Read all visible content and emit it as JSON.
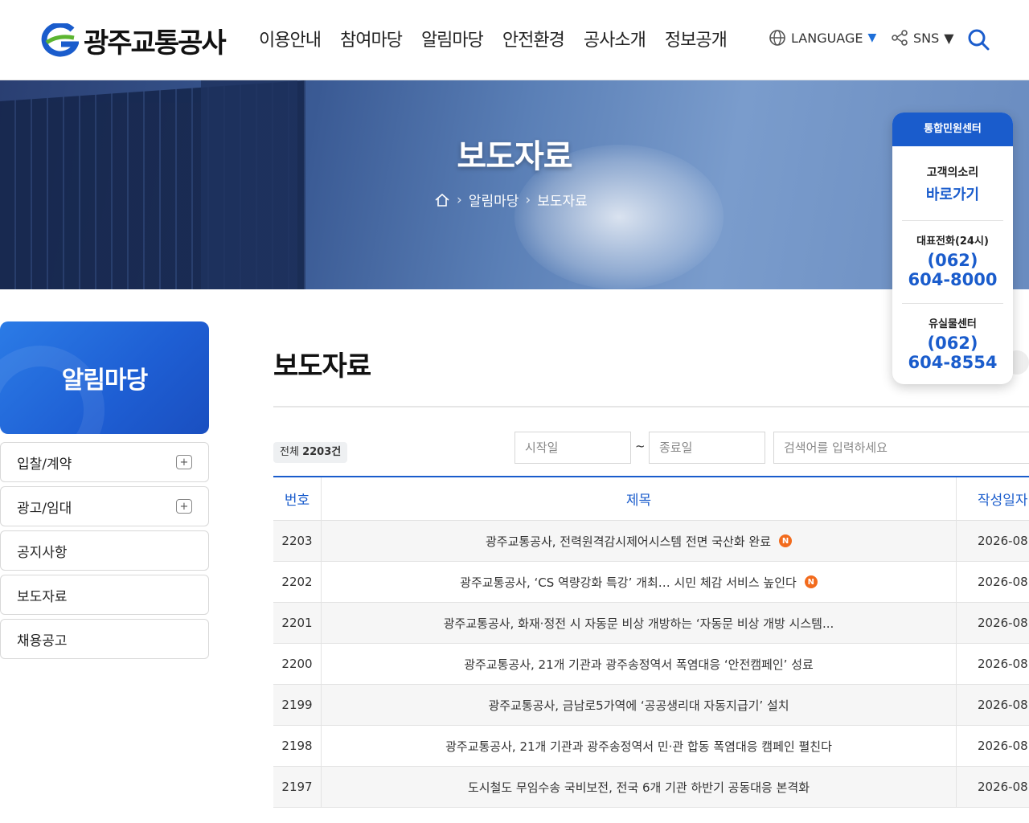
{
  "header": {
    "logo_text": "광주교통공사",
    "nav": [
      "이용안내",
      "참여마당",
      "알림마당",
      "안전환경",
      "공사소개",
      "정보공개"
    ],
    "language_label": "LANGUAGE",
    "sns_label": "SNS",
    "accent": "#1a5ccc"
  },
  "hero": {
    "title": "보도자료",
    "breadcrumb": [
      "알림마당",
      "보도자료"
    ]
  },
  "contact": {
    "head": "통합민원센터",
    "voice_label": "고객의소리",
    "voice_link": "바로가기",
    "main_label": "대표전화(24시)",
    "main_area": "(062)",
    "main_number": "604-8000",
    "lost_label": "유실물센터",
    "lost_area": "(062)",
    "lost_number": "604-8554"
  },
  "side": {
    "title": "알림마당",
    "items": [
      {
        "label": "입찰/계약",
        "expandable": true
      },
      {
        "label": "광고/임대",
        "expandable": true
      },
      {
        "label": "공지사항",
        "expandable": false
      },
      {
        "label": "보도자료",
        "expandable": false
      },
      {
        "label": "채용공고",
        "expandable": false
      }
    ]
  },
  "main": {
    "title": "보도자료",
    "total_prefix": "전체",
    "total_count": "2203건",
    "start_placeholder": "시작일",
    "end_placeholder": "종료일",
    "search_placeholder": "검색어를 입력하세요",
    "tilde": "~"
  },
  "table": {
    "headers": {
      "num": "번호",
      "title": "제목",
      "date": "작성일자"
    },
    "rows": [
      {
        "num": "2203",
        "title": "광주교통공사, 전력원격감시제어시스템 전면 국산화 완료",
        "new": true,
        "date": "2026-08"
      },
      {
        "num": "2202",
        "title": "광주교통공사, ‘CS 역량강화 특강’ 개최… 시민 체감 서비스 높인다",
        "new": true,
        "date": "2026-08"
      },
      {
        "num": "2201",
        "title": "광주교통공사, 화재·정전 시 자동문 비상 개방하는 ‘자동문 비상 개방 시스템...",
        "new": false,
        "date": "2026-08"
      },
      {
        "num": "2200",
        "title": "광주교통공사, 21개 기관과 광주송정역서 폭염대응 ‘안전캠페인’ 성료",
        "new": false,
        "date": "2026-08"
      },
      {
        "num": "2199",
        "title": "광주교통공사, 금남로5가역에 ‘공공생리대 자동지급기’ 설치",
        "new": false,
        "date": "2026-08"
      },
      {
        "num": "2198",
        "title": "광주교통공사, 21개 기관과 광주송정역서 민·관 합동 폭염대응 캠페인 펼친다",
        "new": false,
        "date": "2026-08"
      },
      {
        "num": "2197",
        "title": "도시철도 무임수송 국비보전, 전국 6개 기관 하반기 공동대응 본격화",
        "new": false,
        "date": "2026-08"
      }
    ]
  }
}
